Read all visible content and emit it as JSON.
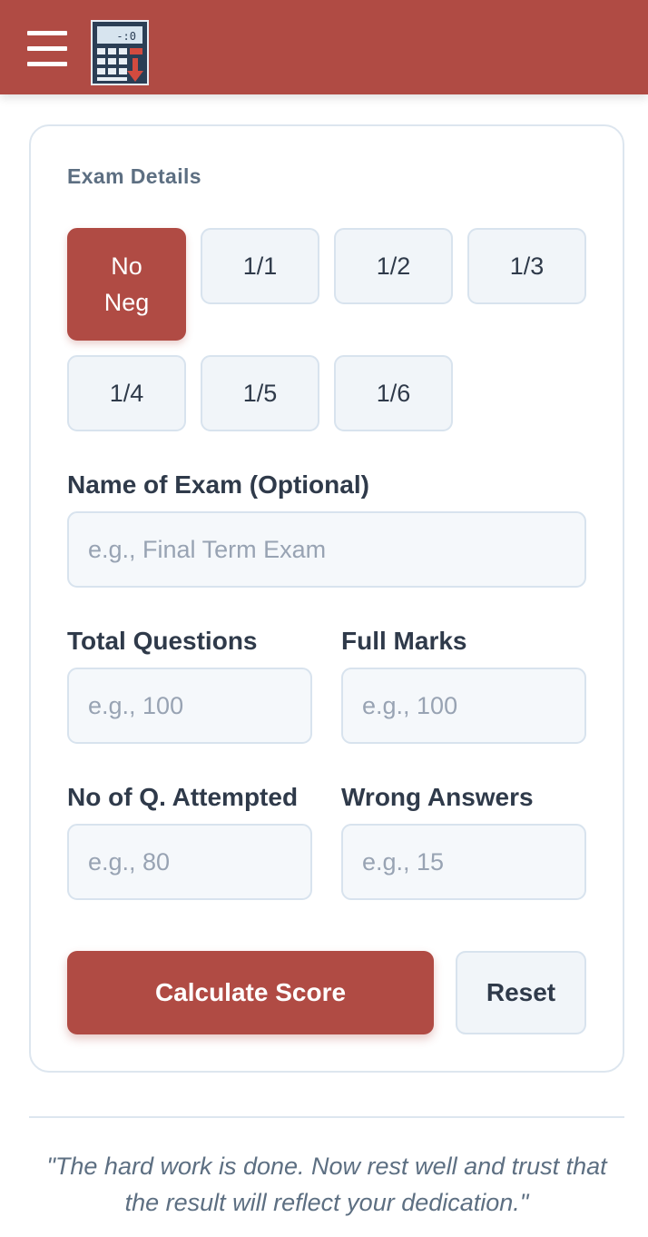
{
  "header": {
    "menu_icon": "hamburger-menu-icon",
    "logo_icon": "calculator-icon",
    "brand_color": "#b04b44"
  },
  "exam_details": {
    "title": "Exam Details",
    "negative_marking_options": [
      {
        "label": "No Neg",
        "selected": true
      },
      {
        "label": "1/1",
        "selected": false
      },
      {
        "label": "1/2",
        "selected": false
      },
      {
        "label": "1/3",
        "selected": false
      },
      {
        "label": "1/4",
        "selected": false
      },
      {
        "label": "1/5",
        "selected": false
      },
      {
        "label": "1/6",
        "selected": false
      }
    ]
  },
  "form": {
    "exam_name": {
      "label": "Name of Exam (Optional)",
      "placeholder": "e.g., Final Term Exam",
      "value": ""
    },
    "total_questions": {
      "label": "Total Questions",
      "placeholder": "e.g., 100",
      "value": ""
    },
    "full_marks": {
      "label": "Full Marks",
      "placeholder": "e.g., 100",
      "value": ""
    },
    "attempted": {
      "label": "No of Q. Attempted",
      "placeholder": "e.g., 80",
      "value": ""
    },
    "wrong_answers": {
      "label": "Wrong Answers",
      "placeholder": "e.g., 15",
      "value": ""
    }
  },
  "actions": {
    "calculate_label": "Calculate Score",
    "reset_label": "Reset"
  },
  "quote": "\"The hard work is done. Now rest well and trust that the result will reflect your dedication.\""
}
